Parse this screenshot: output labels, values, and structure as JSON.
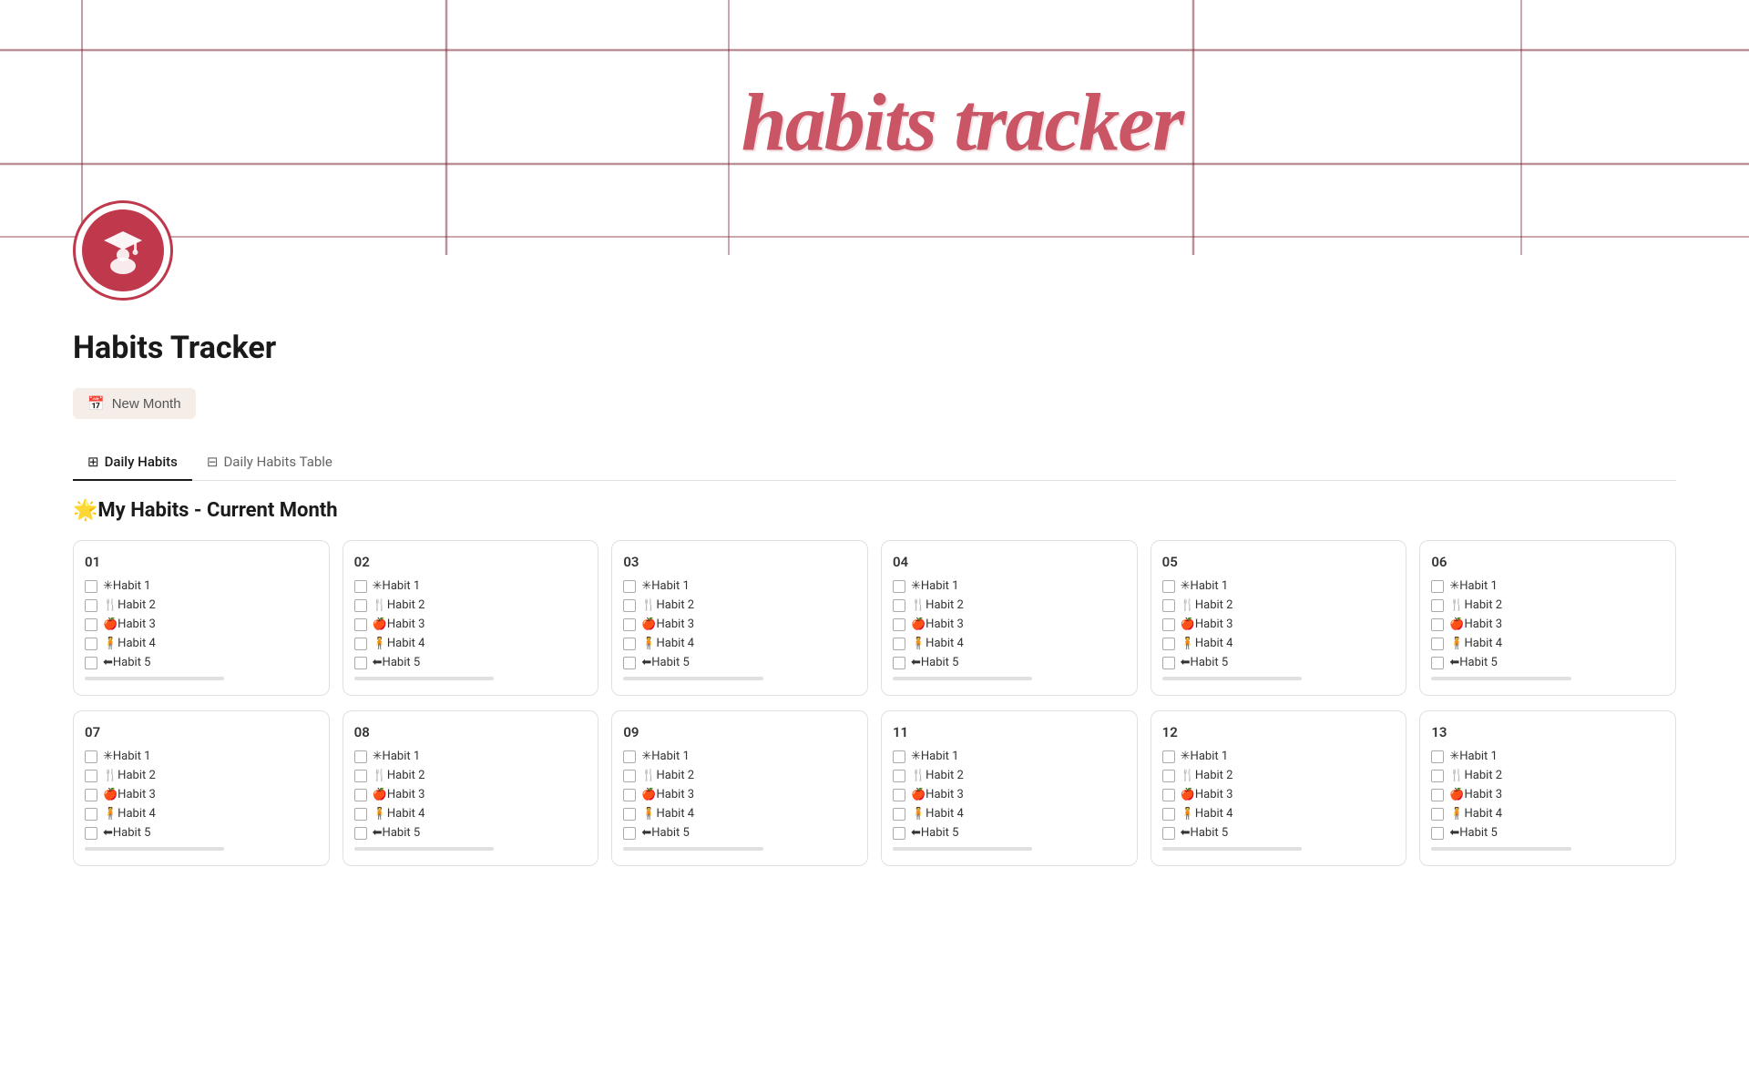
{
  "header": {
    "title_script": "habits tracker",
    "banner_color": "#fff",
    "grid_color": "#8b2a3a"
  },
  "avatar": {
    "aria": "graduation-cap student avatar"
  },
  "page": {
    "title": "Habits Tracker"
  },
  "new_month_button": {
    "label": "New Month",
    "icon": "📅"
  },
  "tabs": [
    {
      "label": "Daily Habits",
      "icon": "⊞",
      "active": true
    },
    {
      "label": "Daily Habits Table",
      "icon": "⊟",
      "active": false
    }
  ],
  "section": {
    "header": "🌟My Habits - Current Month"
  },
  "habits": [
    {
      "emoji": "✳",
      "label": "Habit 1"
    },
    {
      "emoji": "🍴",
      "label": "Habit 2"
    },
    {
      "emoji": "🍎",
      "label": "Habit 3"
    },
    {
      "emoji": "🧍",
      "label": "Habit 4"
    },
    {
      "emoji": "⬅",
      "label": "Habit 5"
    }
  ],
  "days_row1": [
    {
      "num": "01"
    },
    {
      "num": "02"
    },
    {
      "num": "03"
    },
    {
      "num": "04"
    },
    {
      "num": "05"
    },
    {
      "num": "06"
    }
  ],
  "days_row2": [
    {
      "num": "07"
    },
    {
      "num": "08"
    },
    {
      "num": "09"
    },
    {
      "num": "11"
    },
    {
      "num": "12"
    },
    {
      "num": "13"
    }
  ]
}
